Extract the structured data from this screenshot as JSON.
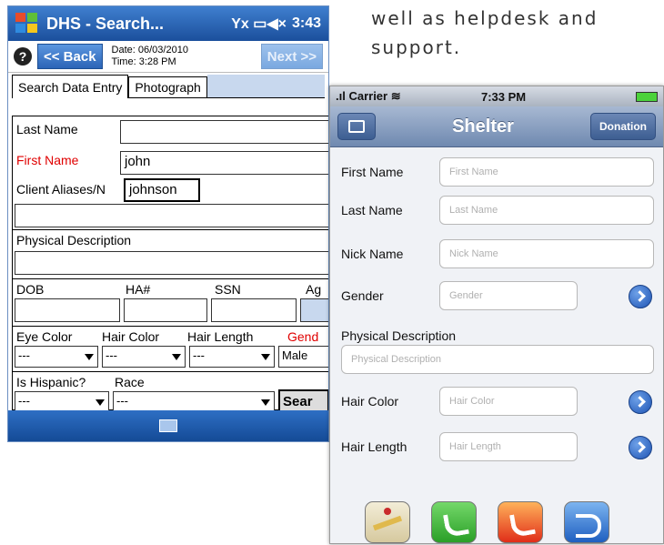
{
  "prose": {
    "line1": "well as helpdesk and",
    "line2": "support."
  },
  "windows_mobile": {
    "title": "DHS - Search...",
    "status_icons": "Yx ▭◀× ",
    "clock": "3:43",
    "help_label": "?",
    "back_label": "<< Back",
    "date": "Date: 06/03/2010",
    "time": "Time: 3:28 PM",
    "next_label": "Next >>",
    "tabs": [
      "Search Data Entry",
      "Photograph"
    ],
    "fields": {
      "last_name_label": "Last Name",
      "last_name_value": "",
      "first_name_label": "First Name",
      "first_name_value": "john",
      "aliases_label": "Client Aliases/N",
      "aliases_value": "johnson",
      "phys_desc_label": "Physical Description",
      "dob_label": "DOB",
      "ha_label": "HA#",
      "ssn_label": "SSN",
      "age_label": "Ag",
      "eye_label": "Eye Color",
      "hair_color_label": "Hair Color",
      "hair_length_label": "Hair Length",
      "gender_label": "Gend",
      "eye_value": "---",
      "hair_color_value": "---",
      "hair_length_value": "---",
      "gender_value": "Male",
      "hispanic_label": "Is Hispanic?",
      "race_label": "Race",
      "hispanic_value": "---",
      "race_value": "---",
      "search_label": "Sear"
    }
  },
  "iphone": {
    "carrier": "Carrier",
    "time": "7:33 PM",
    "title": "Shelter",
    "donation_label": "Donation",
    "fields": [
      {
        "label": "First Name",
        "placeholder": "First Name"
      },
      {
        "label": "Last Name",
        "placeholder": "Last Name"
      },
      {
        "label": "Nick Name",
        "placeholder": "Nick Name"
      },
      {
        "label": "Gender",
        "placeholder": "Gender"
      },
      {
        "label": "Physical Description",
        "placeholder": "Physical Description"
      },
      {
        "label": "Hair Color",
        "placeholder": "Hair Color"
      },
      {
        "label": "Hair Length",
        "placeholder": "Hair Length"
      }
    ],
    "dock_icons": [
      "maps-icon",
      "phone-icon",
      "phone-icon",
      "reply-icon"
    ]
  },
  "colors": {
    "wm_title": "#1b4f9c",
    "wm_required_label": "#e00000",
    "ios_nav": "#6f89b0",
    "ios_disclosure": "#1e54b4"
  }
}
